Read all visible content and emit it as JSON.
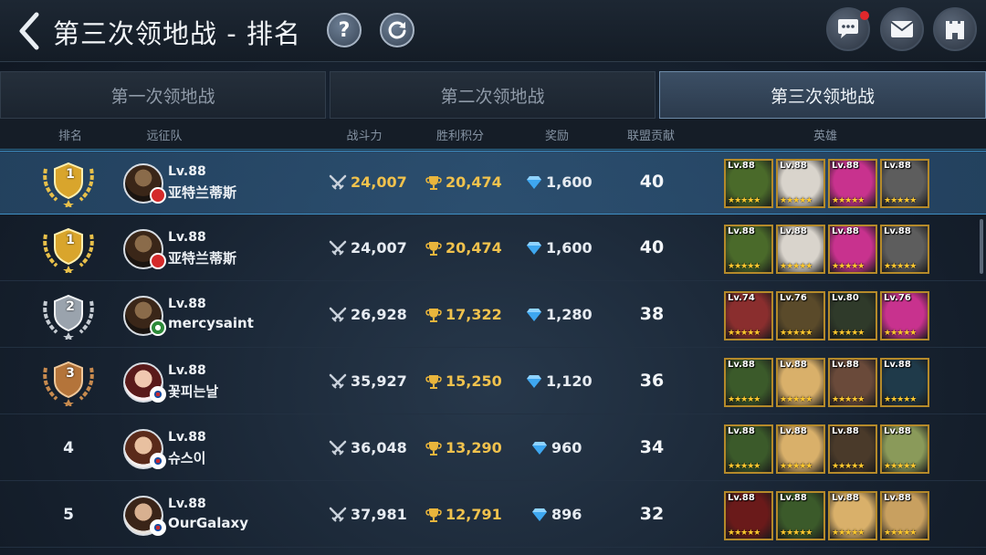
{
  "header": {
    "title": "第三次领地战 - 排名",
    "help_label": "?"
  },
  "tabs": [
    {
      "label": "第一次领地战",
      "active": false
    },
    {
      "label": "第二次领地战",
      "active": false
    },
    {
      "label": "第三次领地战",
      "active": true
    }
  ],
  "columns": {
    "rank": "排名",
    "team": "远征队",
    "power": "战斗力",
    "score": "胜利积分",
    "reward": "奖励",
    "contribution": "联盟贡献",
    "heroes": "英雄"
  },
  "colors": {
    "gold": "#f1c24d",
    "selected_row": "#2b5a80",
    "accent_blue": "#3f8fc4",
    "notify_red": "#e0282c"
  },
  "rows": [
    {
      "rank": "1",
      "badge": "gold",
      "level": "Lv.88",
      "name": "亚特兰蒂斯",
      "flag": "red",
      "power": "24,007",
      "score": "20,474",
      "reward": "1,600",
      "contribution": "40",
      "selected": true,
      "heroes": [
        {
          "lv": "Lv.88",
          "bg": "#4a6a2a"
        },
        {
          "lv": "Lv.88",
          "bg": "#d9d4cc"
        },
        {
          "lv": "Lv.88",
          "bg": "#c8328e"
        },
        {
          "lv": "Lv.88",
          "bg": "#5d5d5d"
        }
      ]
    },
    {
      "rank": "1",
      "badge": "gold",
      "level": "Lv.88",
      "name": "亚特兰蒂斯",
      "flag": "red",
      "power": "24,007",
      "score": "20,474",
      "reward": "1,600",
      "contribution": "40",
      "selected": false,
      "heroes": [
        {
          "lv": "Lv.88",
          "bg": "#4a6a2a"
        },
        {
          "lv": "Lv.88",
          "bg": "#d9d4cc"
        },
        {
          "lv": "Lv.88",
          "bg": "#c8328e"
        },
        {
          "lv": "Lv.88",
          "bg": "#5d5d5d"
        }
      ]
    },
    {
      "rank": "2",
      "badge": "silver",
      "level": "Lv.88",
      "name": "mercysaint",
      "flag": "green",
      "power": "26,928",
      "score": "17,322",
      "reward": "1,280",
      "contribution": "38",
      "selected": false,
      "heroes": [
        {
          "lv": "Lv.74",
          "bg": "#8a2e2e"
        },
        {
          "lv": "Lv.76",
          "bg": "#5a4a2a"
        },
        {
          "lv": "Lv.80",
          "bg": "#2f3a2a"
        },
        {
          "lv": "Lv.76",
          "bg": "#c8328e"
        }
      ]
    },
    {
      "rank": "3",
      "badge": "bronze",
      "level": "Lv.88",
      "name": "꽃피는날",
      "flag": "korea",
      "power": "35,927",
      "score": "15,250",
      "reward": "1,120",
      "contribution": "36",
      "selected": false,
      "heroes": [
        {
          "lv": "Lv.88",
          "bg": "#3b5a2a"
        },
        {
          "lv": "Lv.88",
          "bg": "#d9b06a"
        },
        {
          "lv": "Lv.88",
          "bg": "#6a4a3a"
        },
        {
          "lv": "Lv.88",
          "bg": "#1f3a4a"
        }
      ]
    },
    {
      "rank": "4",
      "badge": "",
      "level": "Lv.88",
      "name": "슈스이",
      "flag": "korea",
      "power": "36,048",
      "score": "13,290",
      "reward": "960",
      "contribution": "34",
      "selected": false,
      "heroes": [
        {
          "lv": "Lv.88",
          "bg": "#3b5a2a"
        },
        {
          "lv": "Lv.88",
          "bg": "#d9b06a"
        },
        {
          "lv": "Lv.88",
          "bg": "#4a3a2a"
        },
        {
          "lv": "Lv.88",
          "bg": "#8a9a5a"
        }
      ]
    },
    {
      "rank": "5",
      "badge": "",
      "level": "Lv.88",
      "name": "OurGalaxy",
      "flag": "korea",
      "power": "37,981",
      "score": "12,791",
      "reward": "896",
      "contribution": "32",
      "selected": false,
      "heroes": [
        {
          "lv": "Lv.88",
          "bg": "#6a1a1a"
        },
        {
          "lv": "Lv.88",
          "bg": "#3b5a2a"
        },
        {
          "lv": "Lv.88",
          "bg": "#d9b06a"
        },
        {
          "lv": "Lv.88",
          "bg": "#c8a060"
        }
      ]
    }
  ]
}
